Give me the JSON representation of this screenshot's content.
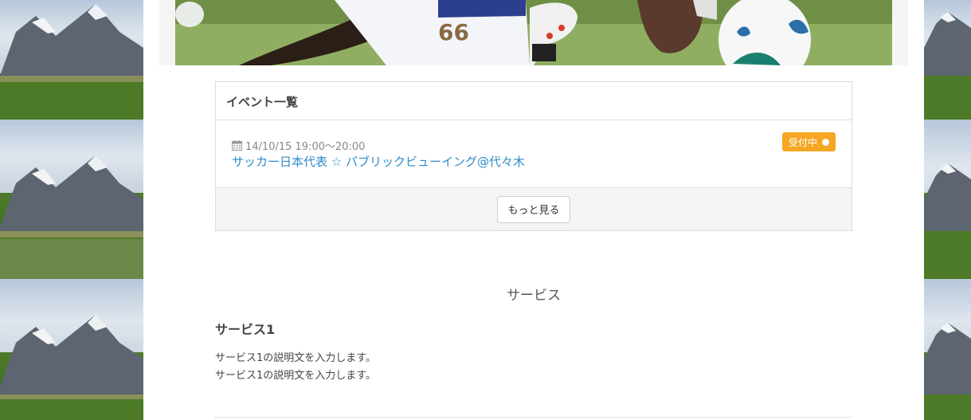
{
  "events": {
    "heading": "イベント一覧",
    "items": [
      {
        "date": "14/10/15 19:00〜20:00",
        "title": "サッカー日本代表 ☆ パブリックビューイング@代々木",
        "status": "受付中"
      }
    ],
    "more_label": "もっと見る"
  },
  "services": {
    "section_title": "サービス",
    "items": [
      {
        "heading": "サービス1",
        "description_lines": [
          "サービス1の説明文を入力します。",
          "サービス1の説明文を入力します。"
        ]
      }
    ]
  },
  "hero": {
    "jersey_number": "66"
  },
  "colors": {
    "link": "#2e8bc9",
    "badge": "#f5a623",
    "panel_border": "#dcdcdc"
  },
  "icons": {
    "date": "calendar-icon",
    "status": "dot-icon"
  }
}
